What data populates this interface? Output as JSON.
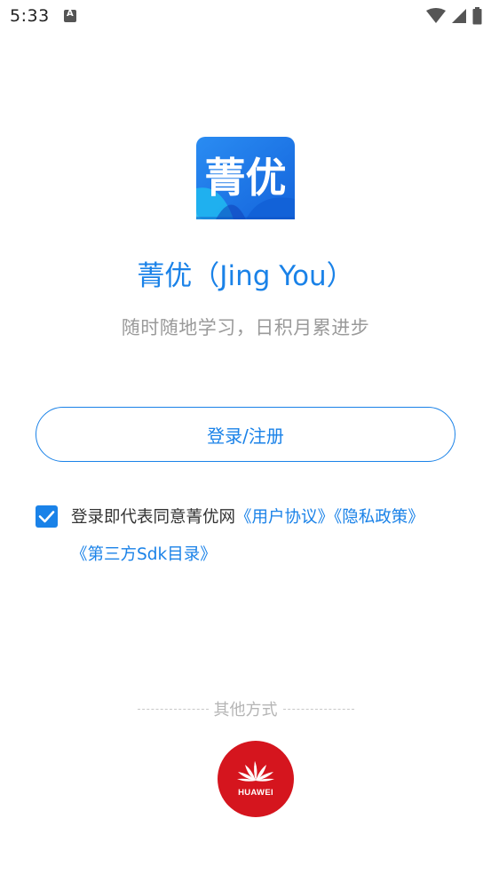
{
  "status_bar": {
    "time": "5:33",
    "icons": [
      "notification-a-icon",
      "wifi-icon",
      "cell-signal-icon",
      "battery-icon"
    ]
  },
  "app": {
    "logo_text": "菁优",
    "title": "菁优（Jing You）",
    "slogan": "随时随地学习，日积月累进步"
  },
  "login": {
    "button_label": "登录/注册"
  },
  "agreement": {
    "checked": true,
    "prefix": "登录即代表同意菁优网",
    "user_agreement": "《用户协议》",
    "privacy_policy": "《隐私政策》",
    "sdk_list": "《第三方Sdk目录》"
  },
  "other_methods": {
    "label": "其他方式",
    "huawei_label": "HUAWEI"
  },
  "colors": {
    "accent": "#1a82e8",
    "huawei_red": "#d5151e",
    "slogan_gray": "#9a9a9a"
  }
}
